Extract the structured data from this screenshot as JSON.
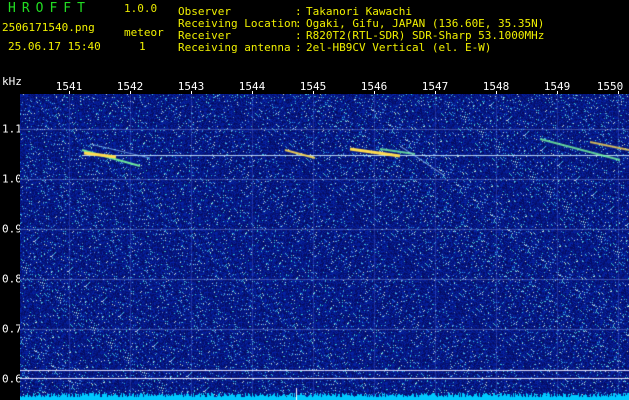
{
  "app": {
    "name": "HROFFT",
    "version": "1.0.0"
  },
  "file": {
    "name": "2506171540.png",
    "datetime": "25.06.17 15:40"
  },
  "detector": {
    "label": "meteor",
    "count": "1"
  },
  "info": [
    {
      "label": "Observer",
      "value": "Takanori Kawachi"
    },
    {
      "label": "Receiving Location",
      "value": "Ogaki, Gifu, JAPAN (136.60E, 35.35N)"
    },
    {
      "label": "Receiver",
      "value": "R820T2(RTL-SDR) SDR-Sharp 53.1000MHz"
    },
    {
      "label": "Receiving antenna",
      "value": "2el-HB9CV Vertical (el. E-W)"
    }
  ],
  "axes": {
    "y_unit": "kHz",
    "x_ticks": [
      "1541",
      "1542",
      "1543",
      "1544",
      "1545",
      "1546",
      "1547",
      "1548",
      "1549",
      "1550"
    ],
    "y_ticks": [
      "1.1",
      "1.0",
      "0.9",
      "0.8",
      "0.7",
      "0.6"
    ]
  },
  "colors": {
    "background": "#000000",
    "header_text": "#f0f000",
    "app_title": "#22dd22",
    "spectrogram_noise": "#0a1a8c",
    "signal": "#ffe060"
  }
}
